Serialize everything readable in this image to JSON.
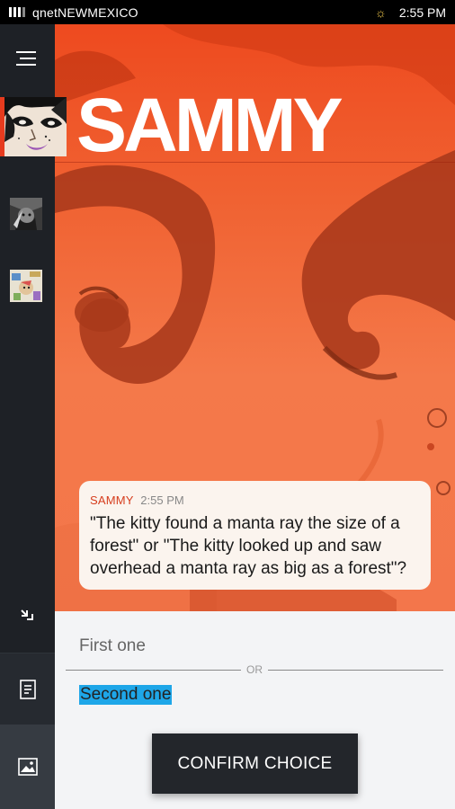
{
  "status_bar": {
    "carrier": "qnetNEWMEXICO",
    "time": "2:55 PM",
    "weather_icon": "sun-icon"
  },
  "sidebar": {
    "menu_icon": "menu-icon",
    "collapse_icon": "collapse-icon",
    "journal_icon": "journal-icon",
    "gallery_icon": "gallery-icon"
  },
  "character": {
    "name": "SAMMY"
  },
  "message": {
    "sender": "SAMMY",
    "time": "2:55 PM",
    "text": "\"The kitty found a manta ray the size of a forest\" or \"The kitty looked up and saw overhead a manta ray as big as a forest\"?"
  },
  "choices": {
    "first": "First one",
    "separator": "OR",
    "second": "Second one",
    "confirm_label": "CONFIRM CHOICE"
  },
  "colors": {
    "accent": "#e63b1e",
    "hero_top": "#ee4a1f",
    "selection": "#1ea6e8",
    "sidebar": "#1e2126"
  }
}
